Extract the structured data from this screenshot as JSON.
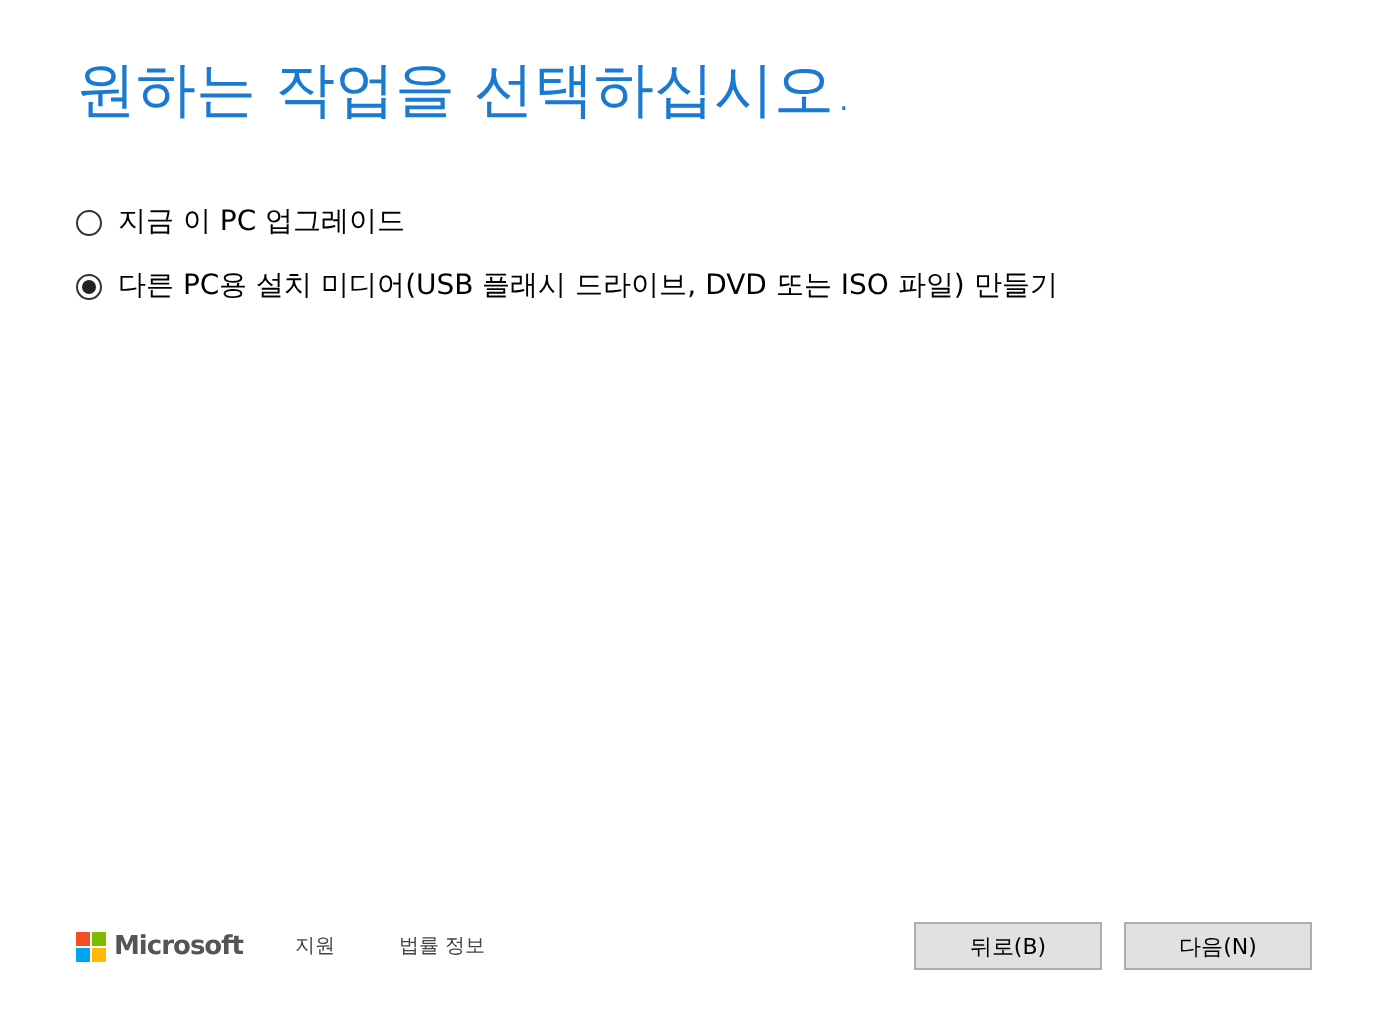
{
  "title": "원하는 작업을 선택하십시오.",
  "options": [
    {
      "label": "지금 이 PC 업그레이드",
      "selected": false
    },
    {
      "label": "다른 PC용 설치 미디어(USB 플래시 드라이브, DVD 또는 ISO 파일) 만들기",
      "selected": true
    }
  ],
  "footer": {
    "brand": "Microsoft",
    "links": [
      "지원",
      "법률 정보"
    ]
  },
  "buttons": [
    "뒤로(B)",
    "다음(N)"
  ]
}
